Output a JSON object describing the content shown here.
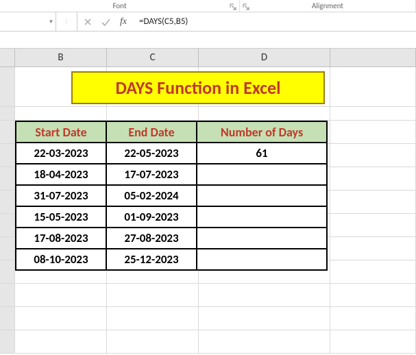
{
  "ribbon": {
    "font_label": "Font",
    "align_label": "Alignment"
  },
  "formula_bar": {
    "name_box": "",
    "formula": "=DAYS(C5,B5)",
    "fx_label": "fx"
  },
  "columns": {
    "B": "B",
    "C": "C",
    "D": "D"
  },
  "title": "DAYS Function in Excel",
  "headers": {
    "start": "Start Date",
    "end": "End Date",
    "days": "Number of Days"
  },
  "rows": [
    {
      "start": "22-03-2023",
      "end": "22-05-2023",
      "days": "61"
    },
    {
      "start": "18-04-2023",
      "end": "17-07-2023",
      "days": ""
    },
    {
      "start": "31-07-2023",
      "end": "05-02-2024",
      "days": ""
    },
    {
      "start": "15-05-2023",
      "end": "01-09-2023",
      "days": ""
    },
    {
      "start": "17-08-2023",
      "end": "27-08-2023",
      "days": ""
    },
    {
      "start": "08-10-2023",
      "end": "25-12-2023",
      "days": ""
    }
  ]
}
